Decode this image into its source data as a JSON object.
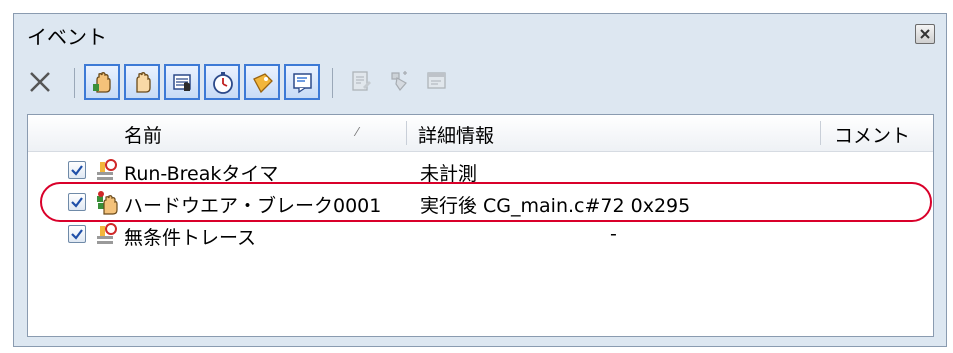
{
  "panel": {
    "title": "イベント"
  },
  "toolbar": {
    "buttons": [
      {
        "icon": "delete-icon"
      },
      {
        "icon": "hardware-break-icon",
        "toggled": true
      },
      {
        "icon": "software-break-icon",
        "toggled": true
      },
      {
        "icon": "trace-icon",
        "toggled": true
      },
      {
        "icon": "timer-icon",
        "toggled": true
      },
      {
        "icon": "coverage-icon",
        "toggled": true
      },
      {
        "icon": "display-icon",
        "toggled": true
      },
      {
        "icon": "edit-condition-icon",
        "disabled": true
      },
      {
        "icon": "set-action-icon",
        "disabled": true
      },
      {
        "icon": "properties-icon",
        "disabled": true
      }
    ]
  },
  "table": {
    "columns": {
      "name": "名前",
      "detail": "詳細情報",
      "comment": "コメント"
    },
    "rows": [
      {
        "checked": true,
        "icon": "timer-event-icon",
        "name": "Run-Breakタイマ",
        "detail": "未計測",
        "comment": ""
      },
      {
        "checked": true,
        "icon": "hardware-break-event-icon",
        "name": "ハードウエア・ブレーク0001",
        "detail": "実行後  CG_main.c#72 0x295",
        "comment": ""
      },
      {
        "checked": true,
        "icon": "trace-event-icon",
        "name": "無条件トレース",
        "detail": "-",
        "comment": ""
      }
    ]
  },
  "colors": {
    "panel_bg": "#dde7f1",
    "toggle_border": "#3d7ad6",
    "highlight": "#d9002a"
  }
}
